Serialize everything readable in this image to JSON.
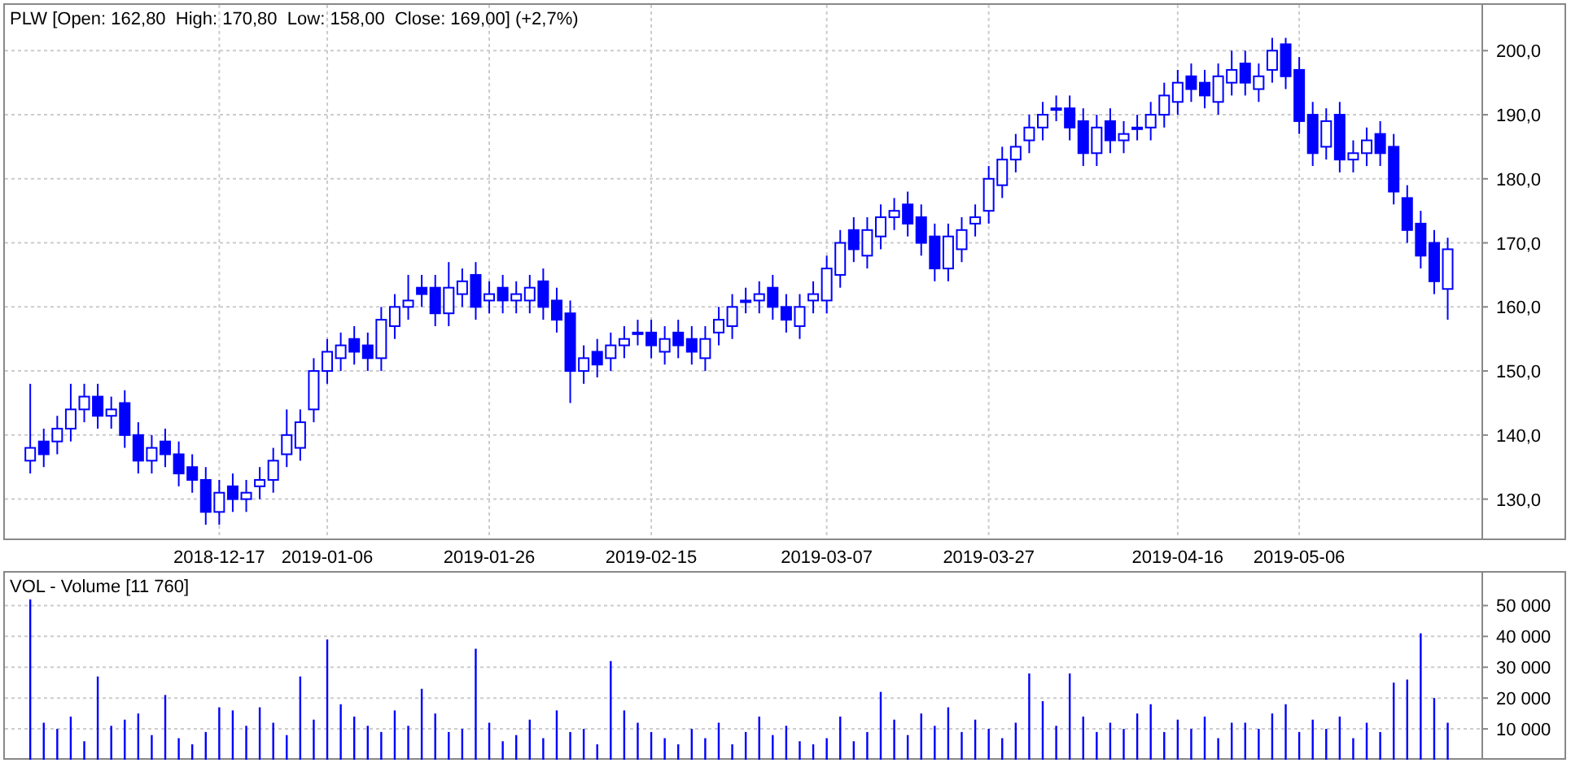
{
  "price_panel": {
    "legend": "PLW [Open: 162,80  High: 170,80  Low: 158,00  Close: 169,00] (+2,7%)",
    "chart_data": {
      "type": "candlestick",
      "grid": true,
      "ylim": [
        123.6,
        207.4
      ],
      "yticks": [
        {
          "value": 130,
          "label": "130,0"
        },
        {
          "value": 140,
          "label": "140,0"
        },
        {
          "value": 150,
          "label": "150,0"
        },
        {
          "value": 160,
          "label": "160,0"
        },
        {
          "value": 170,
          "label": "170,0"
        },
        {
          "value": 180,
          "label": "180,0"
        },
        {
          "value": 190,
          "label": "190,0"
        },
        {
          "value": 200,
          "label": "200,0"
        }
      ],
      "categories": [
        null,
        null,
        null,
        null,
        null,
        null,
        null,
        null,
        null,
        null,
        null,
        null,
        null,
        null,
        "2018-12-17",
        null,
        null,
        null,
        null,
        null,
        null,
        null,
        "2019-01-06",
        null,
        null,
        null,
        null,
        null,
        null,
        null,
        null,
        null,
        null,
        null,
        "2019-01-26",
        null,
        null,
        null,
        null,
        null,
        null,
        null,
        null,
        null,
        null,
        null,
        "2019-02-15",
        null,
        null,
        null,
        null,
        null,
        null,
        null,
        null,
        null,
        null,
        null,
        null,
        "2019-03-07",
        null,
        null,
        null,
        null,
        null,
        null,
        null,
        null,
        null,
        null,
        null,
        "2019-03-27",
        null,
        null,
        null,
        null,
        null,
        null,
        null,
        null,
        null,
        null,
        null,
        null,
        null,
        "2019-04-16",
        null,
        null,
        null,
        null,
        null,
        null,
        null,
        null,
        "2019-05-06",
        null,
        null,
        null,
        null,
        null,
        null,
        null,
        null,
        null,
        null,
        null
      ],
      "ohlc": [
        [
          136,
          148,
          134,
          138
        ],
        [
          139,
          141,
          135,
          137
        ],
        [
          139,
          143,
          137,
          141
        ],
        [
          141,
          148,
          139,
          144
        ],
        [
          144,
          148,
          142,
          146
        ],
        [
          146,
          148,
          141,
          143
        ],
        [
          143,
          146,
          141,
          144
        ],
        [
          145,
          147,
          138,
          140
        ],
        [
          140,
          142,
          134,
          136
        ],
        [
          136,
          140,
          134,
          138
        ],
        [
          139,
          141,
          135,
          137
        ],
        [
          137,
          139,
          132,
          134
        ],
        [
          135,
          137,
          131,
          133
        ],
        [
          133,
          135,
          126,
          128
        ],
        [
          128,
          133,
          126,
          131
        ],
        [
          132,
          134,
          128,
          130
        ],
        [
          130,
          133,
          128,
          131
        ],
        [
          132,
          135,
          130,
          133
        ],
        [
          133,
          138,
          131,
          136
        ],
        [
          137,
          144,
          135,
          140
        ],
        [
          138,
          144,
          136,
          142
        ],
        [
          144,
          152,
          142,
          150
        ],
        [
          150,
          155,
          148,
          153
        ],
        [
          152,
          156,
          150,
          154
        ],
        [
          155,
          157,
          151,
          153
        ],
        [
          154,
          156,
          150,
          152
        ],
        [
          152,
          160,
          150,
          158
        ],
        [
          157,
          162,
          155,
          160
        ],
        [
          160,
          165,
          158,
          161
        ],
        [
          163,
          165,
          160,
          162
        ],
        [
          163,
          165,
          157,
          159
        ],
        [
          159,
          167,
          157,
          163
        ],
        [
          162,
          166,
          160,
          164
        ],
        [
          165,
          167,
          158,
          160
        ],
        [
          161,
          164,
          159,
          162
        ],
        [
          163,
          165,
          159,
          161
        ],
        [
          161,
          164,
          159,
          162
        ],
        [
          161,
          165,
          159,
          163
        ],
        [
          164,
          166,
          158,
          160
        ],
        [
          161,
          163,
          156,
          158
        ],
        [
          159,
          161,
          145,
          150
        ],
        [
          150,
          154,
          148,
          152
        ],
        [
          153,
          155,
          149,
          151
        ],
        [
          152,
          156,
          150,
          154
        ],
        [
          154,
          157,
          152,
          155
        ],
        [
          156,
          158,
          154,
          156
        ],
        [
          156,
          158,
          152,
          154
        ],
        [
          153,
          157,
          151,
          155
        ],
        [
          156,
          158,
          152,
          154
        ],
        [
          155,
          157,
          151,
          153
        ],
        [
          152,
          157,
          150,
          155
        ],
        [
          156,
          160,
          154,
          158
        ],
        [
          157,
          162,
          155,
          160
        ],
        [
          161,
          163,
          159,
          161
        ],
        [
          161,
          164,
          159,
          162
        ],
        [
          163,
          165,
          158,
          160
        ],
        [
          160,
          162,
          156,
          158
        ],
        [
          157,
          162,
          155,
          160
        ],
        [
          161,
          164,
          159,
          162
        ],
        [
          161,
          168,
          159,
          166
        ],
        [
          165,
          172,
          163,
          170
        ],
        [
          172,
          174,
          167,
          169
        ],
        [
          168,
          174,
          166,
          172
        ],
        [
          171,
          176,
          169,
          174
        ],
        [
          174,
          177,
          172,
          175
        ],
        [
          176,
          178,
          171,
          173
        ],
        [
          174,
          176,
          168,
          170
        ],
        [
          171,
          173,
          164,
          166
        ],
        [
          166,
          173,
          164,
          171
        ],
        [
          169,
          174,
          167,
          172
        ],
        [
          173,
          176,
          171,
          174
        ],
        [
          175,
          182,
          173,
          180
        ],
        [
          179,
          185,
          177,
          183
        ],
        [
          183,
          187,
          181,
          185
        ],
        [
          186,
          190,
          184,
          188
        ],
        [
          188,
          192,
          186,
          190
        ],
        [
          191,
          193,
          189,
          191
        ],
        [
          191,
          193,
          186,
          188
        ],
        [
          189,
          191,
          182,
          184
        ],
        [
          184,
          190,
          182,
          188
        ],
        [
          189,
          191,
          184,
          186
        ],
        [
          186,
          189,
          184,
          187
        ],
        [
          188,
          190,
          186,
          188
        ],
        [
          188,
          192,
          186,
          190
        ],
        [
          190,
          195,
          188,
          193
        ],
        [
          192,
          197,
          190,
          195
        ],
        [
          196,
          198,
          192,
          194
        ],
        [
          195,
          197,
          191,
          193
        ],
        [
          192,
          198,
          190,
          196
        ],
        [
          195,
          200,
          193,
          197
        ],
        [
          198,
          200,
          193,
          195
        ],
        [
          194,
          198,
          192,
          196
        ],
        [
          197,
          202,
          195,
          200
        ],
        [
          201,
          202,
          194,
          196
        ],
        [
          197,
          199,
          187,
          189
        ],
        [
          190,
          192,
          182,
          184
        ],
        [
          185,
          191,
          183,
          189
        ],
        [
          190,
          192,
          181,
          183
        ],
        [
          183,
          186,
          181,
          184
        ],
        [
          184,
          188,
          182,
          186
        ],
        [
          187,
          189,
          182,
          184
        ],
        [
          185,
          187,
          176,
          178
        ],
        [
          177,
          179,
          170,
          172
        ],
        [
          173,
          175,
          166,
          168
        ],
        [
          170,
          172,
          162,
          164
        ],
        [
          162.8,
          170.8,
          158,
          169
        ]
      ]
    }
  },
  "volume_panel": {
    "legend": "VOL - Volume [11 760]",
    "chart_data": {
      "type": "bar",
      "grid": true,
      "ylim": [
        0,
        61200
      ],
      "yticks": [
        {
          "value": 10000,
          "label": "10 000"
        },
        {
          "value": 20000,
          "label": "20 000"
        },
        {
          "value": 30000,
          "label": "30 000"
        },
        {
          "value": 40000,
          "label": "40 000"
        },
        {
          "value": 50000,
          "label": "50 000"
        }
      ],
      "series": [
        {
          "color": "#0000ff",
          "values": [
            52000,
            12000,
            10000,
            14000,
            6000,
            27000,
            11000,
            13000,
            15000,
            8000,
            21000,
            7000,
            5000,
            9000,
            17000,
            16000,
            11000,
            17000,
            12000,
            8000,
            27000,
            13000,
            39000,
            18000,
            14000,
            11000,
            9000,
            16000,
            11000,
            23000,
            15000,
            9000,
            10000,
            36000,
            12000,
            6000,
            8000,
            13000,
            7000,
            16000,
            9000,
            10000,
            5000,
            32000,
            16000,
            12000,
            9000,
            7000,
            5000,
            10000,
            7000,
            12000,
            5000,
            9000,
            14000,
            8000,
            11000,
            6000,
            5000,
            7000,
            14000,
            6000,
            9000,
            22000,
            13000,
            8000,
            15000,
            11000,
            17000,
            9000,
            13000,
            10000,
            7000,
            12000,
            28000,
            19000,
            11000,
            28000,
            14000,
            9000,
            12000,
            10000,
            15000,
            18000,
            9000,
            13000,
            10000,
            14000,
            7000,
            12000,
            12000,
            10000,
            15000,
            18000,
            9000,
            13000,
            10000,
            14000,
            7000,
            12000,
            9000,
            25000,
            26000,
            41000,
            20000,
            12000
          ]
        }
      ]
    }
  }
}
